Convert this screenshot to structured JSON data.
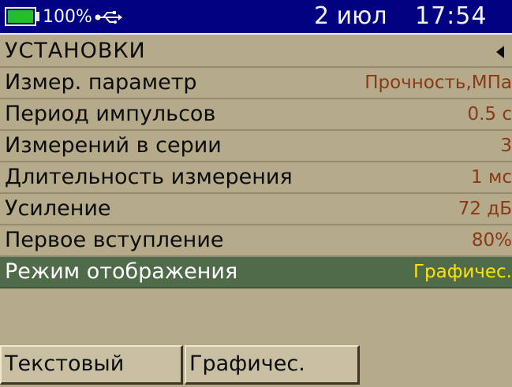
{
  "status": {
    "battery_percent": "100%",
    "battery_level": 1.0,
    "usb_icon": "usb-icon",
    "date": "2 июл",
    "time": "17:54"
  },
  "menu": {
    "title": "УСТАНОВКИ",
    "back_icon": "back-arrow-icon",
    "items": [
      {
        "label": "Измер. параметр",
        "value": "Прочность,МПа"
      },
      {
        "label": "Период импульсов",
        "value": "0.5 с"
      },
      {
        "label": "Измерений в серии",
        "value": "3"
      },
      {
        "label": "Длительность измерения",
        "value": "1 мс"
      },
      {
        "label": "Усиление",
        "value": "72 дБ"
      },
      {
        "label": "Первое вступление",
        "value": "80%"
      },
      {
        "label": "Режим отображения",
        "value": "Графичес.",
        "selected": true
      }
    ]
  },
  "options": {
    "text_label": "Текстовый",
    "graph_label": "Графичес."
  },
  "colors": {
    "background": "#b5ab8b",
    "status_bar": "#000080",
    "selected_row": "#4f6b4a",
    "selected_value": "#ffe300",
    "value_text": "#8a3818",
    "battery_fill": "#1fbf2d"
  }
}
